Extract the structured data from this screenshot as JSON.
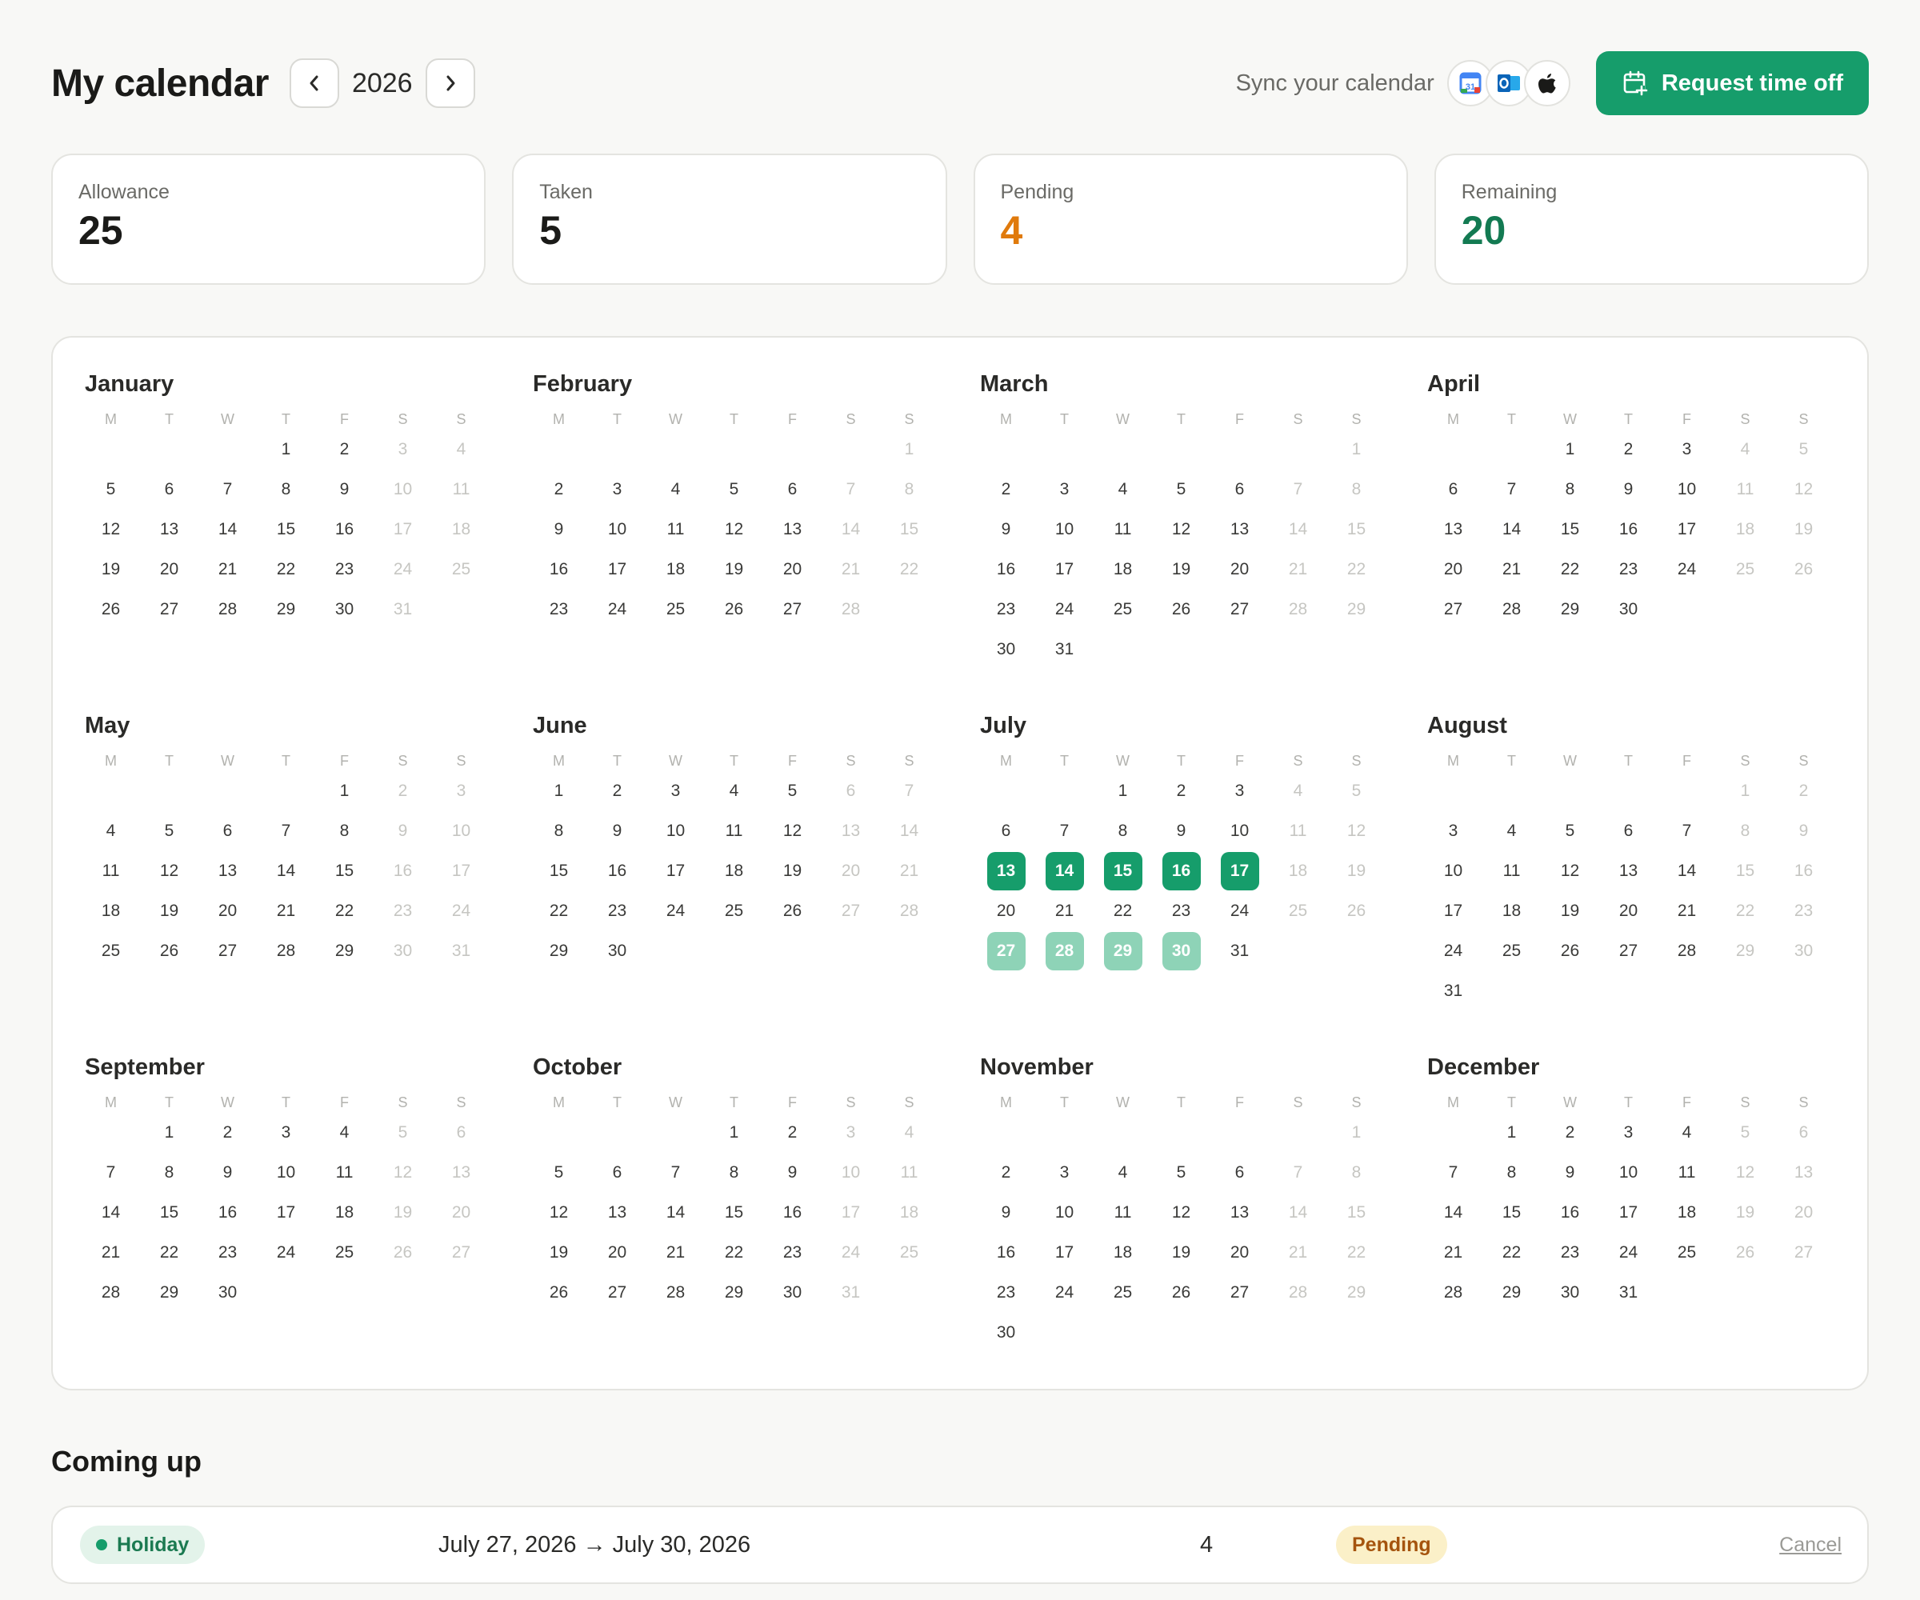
{
  "header": {
    "title": "My calendar",
    "year": "2026",
    "prev_label": "‹",
    "next_label": "›",
    "sync_label": "Sync your calendar",
    "sync_icons": [
      "google-calendar-icon",
      "outlook-icon",
      "apple-icon"
    ],
    "request_button": "Request time off"
  },
  "stats": [
    {
      "label": "Allowance",
      "value": "25",
      "color": "#1a1a18"
    },
    {
      "label": "Taken",
      "value": "5",
      "color": "#1a1a18"
    },
    {
      "label": "Pending",
      "value": "4",
      "color": "#e07a0c"
    },
    {
      "label": "Remaining",
      "value": "20",
      "color": "#137a52"
    }
  ],
  "calendar": {
    "weekday_labels": [
      "M",
      "T",
      "W",
      "T",
      "F",
      "S",
      "S"
    ],
    "months": [
      {
        "name": "January",
        "offset": 3,
        "days": 31
      },
      {
        "name": "February",
        "offset": 6,
        "days": 28
      },
      {
        "name": "March",
        "offset": 6,
        "days": 31
      },
      {
        "name": "April",
        "offset": 2,
        "days": 30
      },
      {
        "name": "May",
        "offset": 4,
        "days": 31
      },
      {
        "name": "June",
        "offset": 0,
        "days": 30
      },
      {
        "name": "July",
        "offset": 2,
        "days": 31,
        "taken": [
          13,
          14,
          15,
          16,
          17
        ],
        "pending": [
          27,
          28,
          29,
          30
        ]
      },
      {
        "name": "August",
        "offset": 5,
        "days": 31
      },
      {
        "name": "September",
        "offset": 1,
        "days": 30
      },
      {
        "name": "October",
        "offset": 3,
        "days": 31
      },
      {
        "name": "November",
        "offset": 6,
        "days": 30
      },
      {
        "name": "December",
        "offset": 1,
        "days": 31
      }
    ]
  },
  "coming_up": {
    "title": "Coming up",
    "items": [
      {
        "type": "Holiday",
        "range": "July 27, 2026 → July 30, 2026",
        "days": "4",
        "status": "Pending",
        "action": "Cancel"
      }
    ]
  },
  "colors": {
    "accent": "#169d6b",
    "pending_chip": "#8ed3b7",
    "pending_badge": "#fbf0c8"
  }
}
